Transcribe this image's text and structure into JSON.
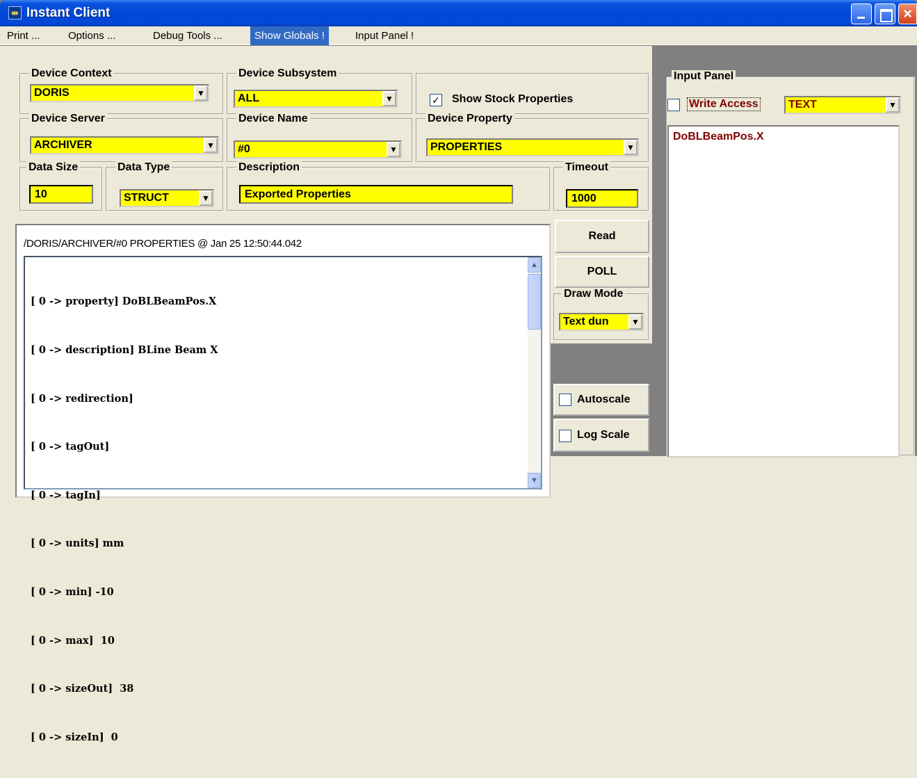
{
  "window": {
    "title": "Instant Client",
    "icon": "app-icon"
  },
  "menu": [
    "Print ...",
    "Options ...",
    "Debug Tools ...",
    "Show Globals !",
    "Input Panel !"
  ],
  "device_context": {
    "label": "Device Context",
    "value": "DORIS"
  },
  "device_subsystem": {
    "label": "Device Subsystem",
    "value": "ALL"
  },
  "show_stock": {
    "label": "Show Stock Properties",
    "checked": true
  },
  "device_server": {
    "label": "Device Server",
    "value": "ARCHIVER"
  },
  "device_name": {
    "label": "Device Name",
    "value": "#0"
  },
  "device_property": {
    "label": "Device Property",
    "value": "PROPERTIES"
  },
  "data_size": {
    "label": "Data Size",
    "value": "10"
  },
  "data_type": {
    "label": "Data Type",
    "value": "STRUCT"
  },
  "description": {
    "label": "Description",
    "value": "Exported Properties"
  },
  "timeout": {
    "label": "Timeout",
    "value": "1000"
  },
  "output": {
    "header": "/DORIS/ARCHIVER/#0 PROPERTIES @ Jan 25 12:50:44.042",
    "lines": [
      "[ 0 -> property] DoBLBeamPos.X",
      "[ 0 -> description] BLine Beam X",
      "[ 0 -> redirection]",
      "[ 0 -> tagOut]",
      "[ 0 -> tagIn]",
      "[ 0 -> units] mm",
      "[ 0 -> min] -10",
      "[ 0 -> max]  10",
      "[ 0 -> sizeOut]  38",
      "[ 0 -> sizeIn]  0"
    ]
  },
  "buttons": {
    "read": "Read",
    "poll": "POLL"
  },
  "draw_mode": {
    "label": "Draw Mode",
    "value": "Text dun"
  },
  "autoscale": {
    "label": "Autoscale",
    "checked": false
  },
  "log_scale": {
    "label": "Log Scale",
    "checked": false
  },
  "input_panel": {
    "label": "Input Panel",
    "write_access": {
      "label": "Write Access",
      "checked": false
    },
    "format": "TEXT",
    "text": "DoBLBeamPos.X"
  },
  "colors": {
    "field_bg": "#ffff00",
    "accent_text": "#800000",
    "title_blue": "#0048d6"
  }
}
